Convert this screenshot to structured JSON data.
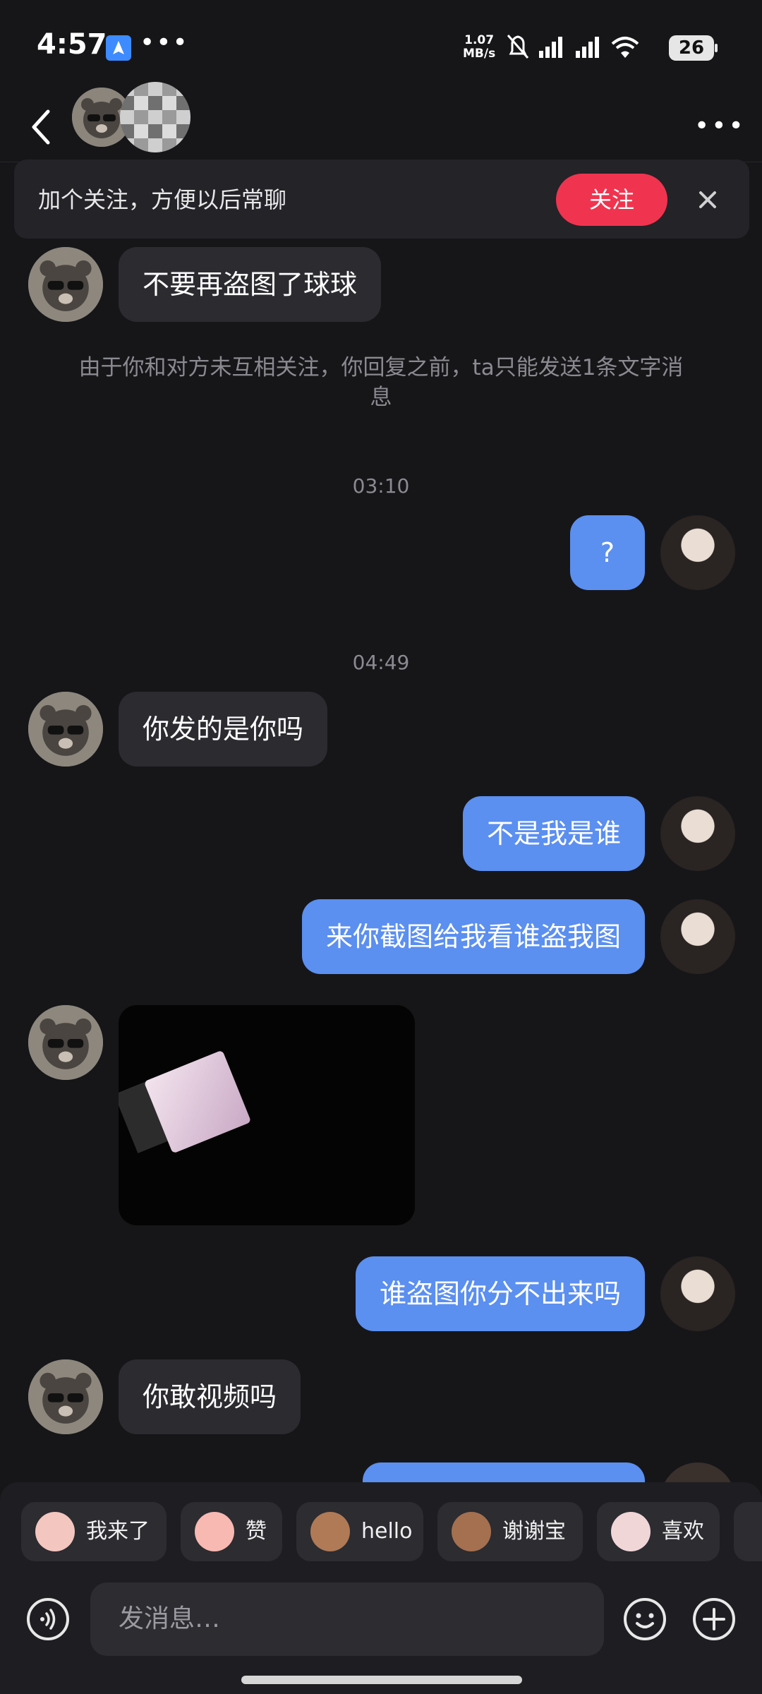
{
  "status_bar": {
    "time": "4:57",
    "network_speed_value": "1.07",
    "network_speed_unit": "MB/s",
    "battery": "26"
  },
  "header": {
    "contact_avatar": "bear-with-sunglasses",
    "contact_name_blurred": true
  },
  "follow_banner": {
    "text": "加个关注，方便以后常聊",
    "follow_label": "关注",
    "accent": "#f0344f"
  },
  "messages": {
    "m1": "不要再盗图了球球",
    "system_note": "由于你和对方未互相关注，你回复之前，ta只能发送1条文字消息",
    "ts1": "03:10",
    "m2": "?",
    "ts2": "04:49",
    "m3": "你发的是你吗",
    "m4": "不是我是谁",
    "m5": "来你截图给我看谁盗我图",
    "m6_type": "image",
    "m7": "谁盗图你分不出来吗",
    "m8": "你敢视频吗"
  },
  "quick_replies": [
    {
      "label": "我来了",
      "icon": "sticker-face-icon"
    },
    {
      "label": "赞",
      "icon": "sticker-thumbs-icon"
    },
    {
      "label": "hello",
      "icon": "sticker-monkey-icon"
    },
    {
      "label": "谢谢宝",
      "icon": "sticker-monkey-flower-icon"
    },
    {
      "label": "喜欢",
      "icon": "sticker-heart-icon"
    }
  ],
  "input": {
    "placeholder": "发消息…"
  },
  "colors": {
    "background": "#161619",
    "incoming_bubble": "#2b2b30",
    "outgoing_bubble": "#5b8ff0"
  }
}
